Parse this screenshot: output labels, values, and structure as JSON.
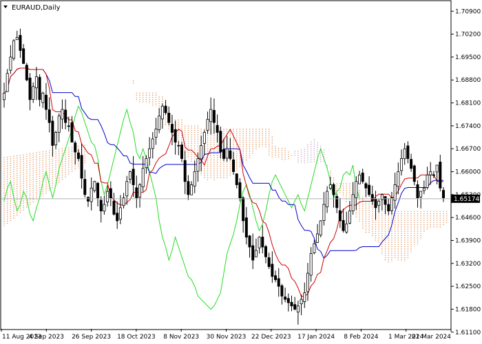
{
  "chart_data": {
    "type": "candlestick",
    "title": "EURAUD,Daily",
    "ylim": [
      1.612,
      1.712
    ],
    "y_ticks": [
      "1.70900",
      "1.70200",
      "1.69500",
      "1.68800",
      "1.68100",
      "1.67400",
      "1.66700",
      "1.66000",
      "1.65300",
      "1.64600",
      "1.63900",
      "1.63200",
      "1.62500",
      "1.61800",
      "1.61100"
    ],
    "x_ticks": [
      "11 Aug 2023",
      "4 Sep 2023",
      "26 Sep 2023",
      "18 Oct 2023",
      "8 Nov 2023",
      "30 Nov 2023",
      "22 Dec 2023",
      "17 Jan 2024",
      "8 Feb 2024",
      "1 Mar 2024",
      "21 Mar 2024"
    ],
    "current_price": "1.65174",
    "indicators": [
      "Tenkan-sen",
      "Kijun-sen",
      "Chikou Span",
      "Senkou Span A",
      "Senkou Span B"
    ],
    "colors": {
      "candle": "#000000",
      "tenkan": "#cc0000",
      "kijun": "#0000cc",
      "chikou": "#22dd22",
      "cloud": "#e0915a",
      "cloud_alt": "#c8a0c8",
      "grid_line": "#b0b0b0",
      "price_tag_bg": "#000000"
    },
    "close_series": [
      1.684,
      1.69,
      1.695,
      1.7,
      1.701,
      1.697,
      1.693,
      1.688,
      1.682,
      1.686,
      1.689,
      1.682,
      1.684,
      1.679,
      1.675,
      1.668,
      1.672,
      1.677,
      1.679,
      1.675,
      1.674,
      1.669,
      1.666,
      1.664,
      1.658,
      1.653,
      1.651,
      1.655,
      1.657,
      1.652,
      1.648,
      1.65,
      1.654,
      1.652,
      1.647,
      1.645,
      1.649,
      1.652,
      1.657,
      1.66,
      1.656,
      1.652,
      1.656,
      1.661,
      1.664,
      1.667,
      1.67,
      1.673,
      1.677,
      1.68,
      1.678,
      1.675,
      1.672,
      1.669,
      1.668,
      1.664,
      1.657,
      1.653,
      1.656,
      1.66,
      1.664,
      1.668,
      1.672,
      1.676,
      1.679,
      1.675,
      1.672,
      1.666,
      1.664,
      1.667,
      1.664,
      1.66,
      1.656,
      1.652,
      1.645,
      1.64,
      1.637,
      1.633,
      1.636,
      1.64,
      1.637,
      1.634,
      1.631,
      1.628,
      1.627,
      1.625,
      1.622,
      1.621,
      1.62,
      1.619,
      1.618,
      1.619,
      1.621,
      1.623,
      1.629,
      1.635,
      1.638,
      1.641,
      1.645,
      1.65,
      1.654,
      1.656,
      1.653,
      1.649,
      1.645,
      1.642,
      1.644,
      1.648,
      1.653,
      1.657,
      1.659,
      1.657,
      1.655,
      1.653,
      1.651,
      1.649,
      1.651,
      1.653,
      1.65,
      1.648,
      1.652,
      1.656,
      1.66,
      1.664,
      1.667,
      1.664,
      1.661,
      1.657,
      1.652,
      1.654,
      1.655,
      1.659,
      1.66,
      1.659,
      1.662,
      1.655,
      1.652
    ],
    "y_labels_position": "right",
    "grid": false
  }
}
